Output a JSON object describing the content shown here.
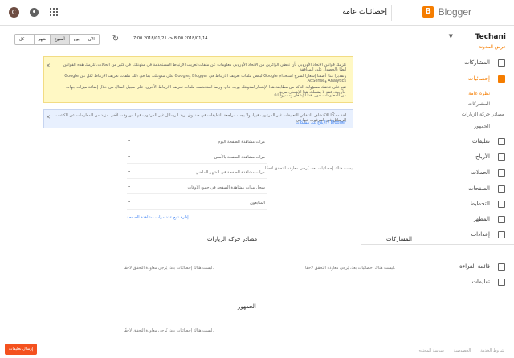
{
  "header": {
    "brand": "Blogger",
    "logo_letter": "B",
    "page_title": "إحصائيات عامة",
    "avatar_letter": "C"
  },
  "sidebar": {
    "blog_name": "Techani",
    "view_blog": "عرض المدونة",
    "items": [
      {
        "label": "المشاركات"
      },
      {
        "label": "إحصائيات"
      },
      {
        "label": "تعليقات"
      },
      {
        "label": "الأرباح"
      },
      {
        "label": "الحملات"
      },
      {
        "label": "الصفحات"
      },
      {
        "label": "التخطيط"
      },
      {
        "label": "المظهر"
      },
      {
        "label": "إعدادات"
      },
      {
        "label": "قائمة القراءة"
      },
      {
        "label": "تعليمات"
      }
    ],
    "subitems": [
      {
        "label": "نظرة عامة"
      },
      {
        "label": "المشاركات"
      },
      {
        "label": "مصادر حركة الزيارات"
      },
      {
        "label": "الجمهور"
      }
    ],
    "footer_links": [
      "شروط الخدمة",
      "الخصوصية",
      "سياسة المحتوى"
    ]
  },
  "toolbar": {
    "periods": [
      "كل الوقت",
      "شهر",
      "أسبوع",
      "يوم",
      "الآن"
    ],
    "selected": "أسبوع",
    "date_range": "7:00 2018/01/21 -> 8:00 2018/01/14"
  },
  "notice": {
    "lines": [
      "تلزمك قوانين الاتحاد الأوروبي بأن تعطي الزائرين من الاتحاد الأوروبي معلومات عن ملفات تعريف الارتباط المستخدمة في مدونتك. في كثير من الحالات، تلزمك هذه القوانين أيضًا بالحصول على الموافقة",
      "وتقديرًا منا، أضفنا إشعارًا لشرح استخدام Google لبعض ملفات تعريف الارتباط في Blogger وGoogle على مدونتك، بما في ذلك ملفات تعريف الارتباط لكل من Google Analytics وAdSense",
      "تقع على عاتقك مسؤولية التأكد من مطابقة هذا الإشعار لمدونتك بوجه عام. وربما استخدمت ملفات تعريف الارتباط الأخرى، على سبيل المثال من خلال إضافة ميزات جهات خارجية، فقد لا يشملك هذا الإشعار. مزيد",
      "من المعلومات حول هذا الإشعار ومسؤولياتك"
    ]
  },
  "info": {
    "lines": [
      "لقد ممكّنا الاكتشاف التلقائي للتعليقات غير المرغوب فيها، ولا يجب مراجعة التعليقات في صندوق بريد الرسائل غير المرغوب فيها من وقت لآخر. مزيد من المعلومات عن الكشف الرسائل غير المرغوب فيها في",
      "Blogger / الإبلاغ عن مشكلات"
    ]
  },
  "stats": {
    "rows": [
      {
        "label": "مرات مشاهدة الصفحة اليوم",
        "value": "-"
      },
      {
        "label": "مرات مشاهدة الصفحة بالأمس",
        "value": "-"
      },
      {
        "label": "مرات مشاهدة الصفحة في الشهر الماضي",
        "value": "-"
      },
      {
        "label": "سجل مرات مشاهدة الصفحة في جميع الأوقات",
        "value": "-"
      },
      {
        "label": "المتابعون",
        "value": "-"
      }
    ],
    "link": "إدارة تتبع عدد مرات مشاهدة الصفحة"
  },
  "chart_msg": "ليست هناك إحصائيات بعد، يُرجى معاودة التحقق لاحقًا.",
  "sections": {
    "posts": {
      "title": "المشاركات",
      "msg": "ليست هناك إحصائيات بعد، يُرجى معاودة التحقق لاحقًا."
    },
    "traffic": {
      "title": "مصادر حركة الزيارات",
      "msg": "ليست هناك إحصائيات بعد، يُرجى معاودة التحقق لاحقًا."
    },
    "audience": {
      "title": "الجمهور",
      "msg": "ليست هناك إحصائيات بعد، يُرجى معاودة التحقق لاحقًا."
    }
  },
  "feedback": "إرسال تعليقات"
}
